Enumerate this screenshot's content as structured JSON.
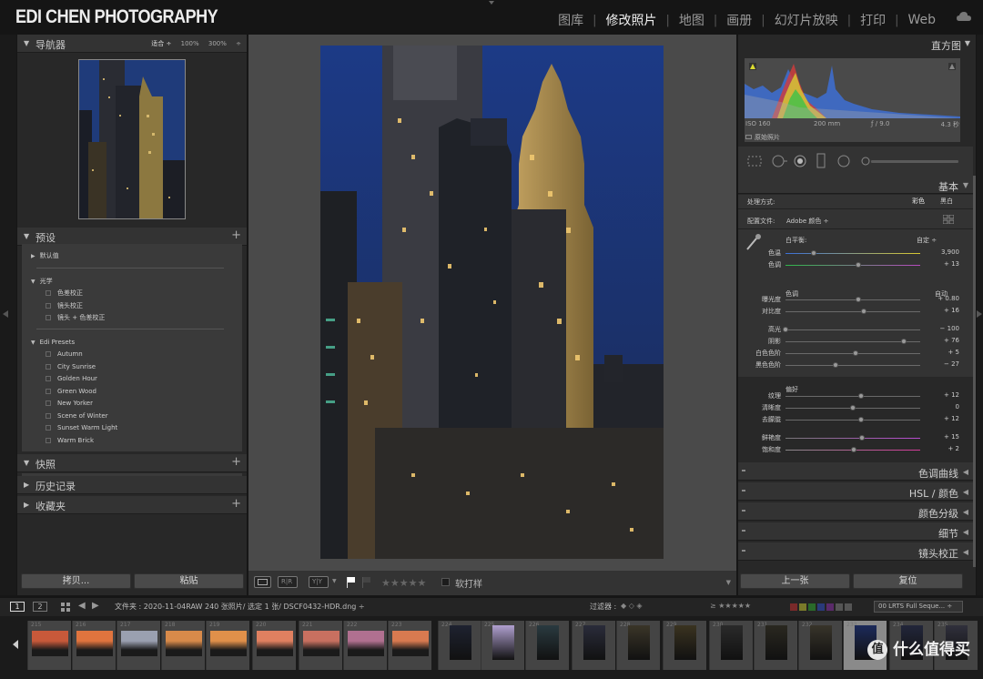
{
  "brand": "EDI CHEN PHOTOGRAPHY",
  "modules": [
    "图库",
    "修改照片",
    "地图",
    "画册",
    "幻灯片放映",
    "打印",
    "Web"
  ],
  "active_module": 1,
  "left": {
    "navigator": {
      "title": "导航器",
      "options": [
        "适合 ÷",
        "100%",
        "300%",
        "÷"
      ]
    },
    "presets": {
      "title": "预设",
      "groups": [
        {
          "label": "默认值",
          "items": []
        },
        {
          "label": "光学",
          "items": [
            "色差校正",
            "镜头校正",
            "镜头 + 色差校正"
          ]
        },
        {
          "label": "Edi Presets",
          "items": [
            "Autumn",
            "City Sunrise",
            "Golden Hour",
            "Green Wood",
            "New Yorker",
            "Scene of Winter",
            "Sunset Warm Light",
            "Warm Brick"
          ]
        }
      ]
    },
    "snapshots": "快照",
    "history": "历史记录",
    "collections": "收藏夹",
    "copy_btn": "拷贝...",
    "paste_btn": "粘贴"
  },
  "center": {
    "toolbar": {
      "softproof_label": "软打样",
      "rating_stars": "★★★★★"
    }
  },
  "right": {
    "histogram": {
      "title": "直方图",
      "iso": "ISO 160",
      "focal": "200 mm",
      "aperture": "ƒ / 9.0",
      "shutter": "4.3 秒",
      "original_photo": "原始照片"
    },
    "basic": {
      "title": "基本",
      "treatment_label": "处理方式:",
      "treatment_color": "彩色",
      "treatment_bw": "黑白",
      "profile_label": "配置文件:",
      "profile_value": "Adobe 颜色 ÷",
      "wb_label": "白平衡:",
      "wb_value": "自定 ÷",
      "tone_label": "色调",
      "tone_auto": "自动",
      "presence_label": "偏好",
      "sliders": [
        {
          "label": "色温",
          "value": "3,900",
          "pos": 0.21
        },
        {
          "label": "色调",
          "value": "+ 13",
          "pos": 0.54
        },
        {
          "label": "曝光度",
          "value": "+ 0.80",
          "pos": 0.54
        },
        {
          "label": "对比度",
          "value": "+ 16",
          "pos": 0.58
        },
        {
          "label": "高光",
          "value": "− 100",
          "pos": 0.0
        },
        {
          "label": "阴影",
          "value": "+ 76",
          "pos": 0.88
        },
        {
          "label": "白色色阶",
          "value": "+ 5",
          "pos": 0.52
        },
        {
          "label": "黑色色阶",
          "value": "− 27",
          "pos": 0.37
        },
        {
          "label": "纹理",
          "value": "+ 12",
          "pos": 0.56
        },
        {
          "label": "清晰度",
          "value": "0",
          "pos": 0.5
        },
        {
          "label": "去朦胧",
          "value": "+ 12",
          "pos": 0.56
        },
        {
          "label": "鲜艳度",
          "value": "+ 15",
          "pos": 0.57
        },
        {
          "label": "饱和度",
          "value": "+ 2",
          "pos": 0.51
        }
      ]
    },
    "sections": [
      "色调曲线",
      "HSL / 颜色",
      "颜色分级",
      "细节",
      "镜头校正"
    ],
    "prev_btn": "上一张",
    "reset_btn": "复位"
  },
  "filmstrip": {
    "view1": "1",
    "view2": "2",
    "source": "文件夹 : 2020-11-04RAW  240 张照片/ 选定 1 张/ DSCF0432-HDR.dng ÷",
    "filter_label": "过滤器 :",
    "filter_stars": "≥ ★★★★★",
    "filter_preset": "00 LRTS Full Seque... ÷",
    "numbers": [
      "215",
      "216",
      "217",
      "218",
      "219",
      "220",
      "221",
      "222",
      "223",
      "224",
      "225",
      "226",
      "227",
      "228",
      "229",
      "230",
      "231",
      "232",
      "233",
      "234",
      "235"
    ]
  },
  "watermark": "什么值得买",
  "colors": {
    "accent": "#ffffff",
    "panel": "#282828",
    "center_bg": "#4a4a4a"
  }
}
